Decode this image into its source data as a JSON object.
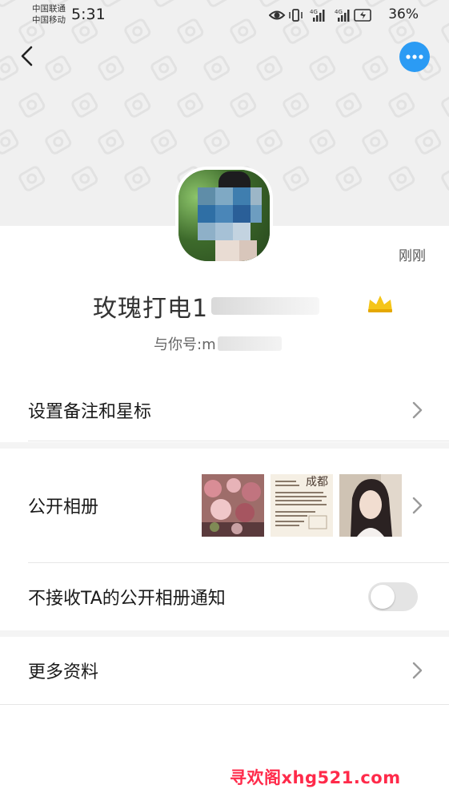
{
  "status_bar": {
    "carrier_1": "中国联通",
    "carrier_2": "中国移动",
    "time": "5:31",
    "battery": "36%",
    "network_1": "4G",
    "network_2": "4G"
  },
  "header": {
    "back_icon": "chevron-left-icon",
    "more_icon": "more-horizontal-icon",
    "more_button_color": "#2b9bf4"
  },
  "profile": {
    "last_seen": "刚刚",
    "name": "玫瑰打电1",
    "relation_label": "与你号:m"
  },
  "menu": {
    "remark_label": "设置备注和星标",
    "album_label": "公开相册",
    "album_thumbs": [
      {
        "description_icon": "album-photo-flowers"
      },
      {
        "description_icon": "album-photo-text-poster",
        "title": "成都"
      },
      {
        "description_icon": "album-photo-portrait"
      }
    ],
    "mute_album_label": "不接收TA的公开相册通知",
    "mute_album_enabled": false,
    "more_info_label": "更多资料"
  },
  "watermark": "寻欢阁xhg521.com"
}
